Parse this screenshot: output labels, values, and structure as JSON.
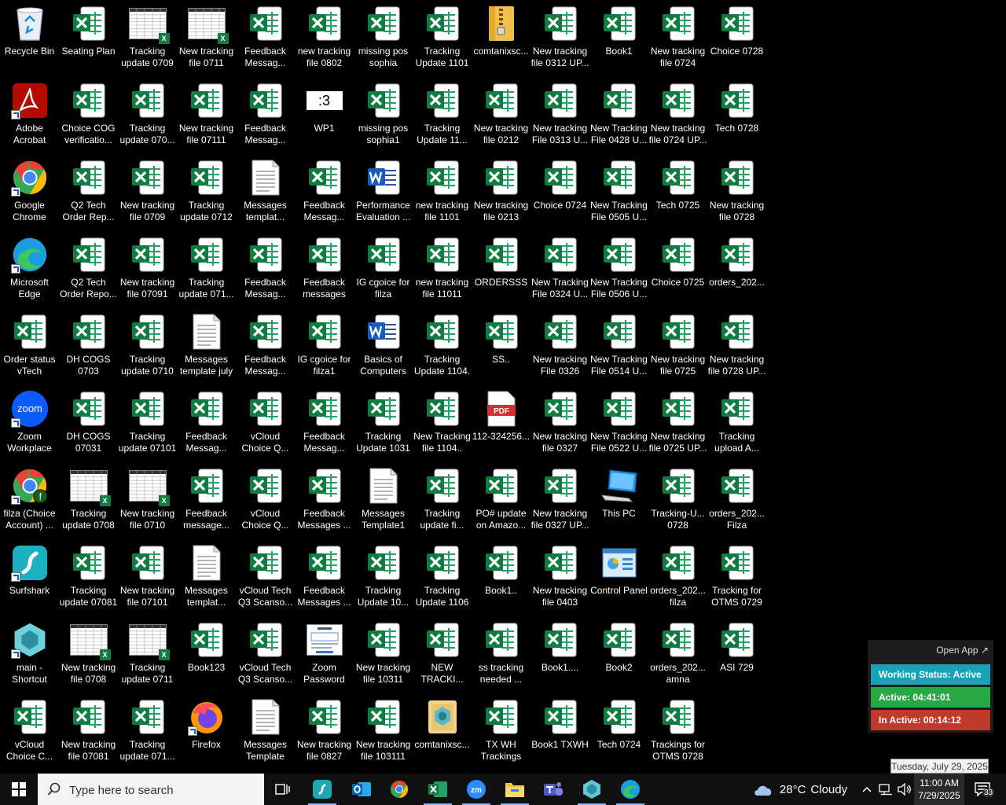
{
  "desktop": {
    "columns": [
      [
        {
          "label": "Recycle Bin",
          "type": "recycle"
        },
        {
          "label": "Adobe Acrobat",
          "type": "acrobat",
          "shortcut": true
        },
        {
          "label": "Google Chrome",
          "type": "chrome",
          "shortcut": true
        },
        {
          "label": "Microsoft Edge",
          "type": "edge",
          "shortcut": true
        },
        {
          "label": "Order status vTech",
          "type": "excel"
        },
        {
          "label": "Zoom Workplace",
          "type": "zoom",
          "shortcut": true
        },
        {
          "label": "filza (Choice Account) ...",
          "type": "chrome-profile",
          "shortcut": true
        },
        {
          "label": "Surfshark",
          "type": "surfshark",
          "shortcut": true
        },
        {
          "label": "main - Shortcut",
          "type": "main",
          "shortcut": true
        },
        {
          "label": "vCloud Choice C...",
          "type": "excel"
        }
      ],
      [
        {
          "label": "Seating Plan",
          "type": "excel"
        },
        {
          "label": "Choice COG verificatio...",
          "type": "excel"
        },
        {
          "label": "Q2 Tech Order Rep...",
          "type": "excel"
        },
        {
          "label": "Q2 Tech Order Repo...",
          "type": "excel"
        },
        {
          "label": "DH COGS 0703",
          "type": "excel"
        },
        {
          "label": "DH COGS 07031",
          "type": "excel"
        },
        {
          "label": "Tracking update 0708",
          "type": "sheet-thumb"
        },
        {
          "label": "Tracking update 07081",
          "type": "excel"
        },
        {
          "label": "New tracking file 0708",
          "type": "sheet-thumb"
        },
        {
          "label": "New tracking file 07081",
          "type": "excel"
        }
      ],
      [
        {
          "label": "Tracking update 0709",
          "type": "sheet-thumb"
        },
        {
          "label": "Tracking update 070...",
          "type": "excel"
        },
        {
          "label": "New tracking file 0709",
          "type": "excel"
        },
        {
          "label": "New tracking file 07091",
          "type": "excel"
        },
        {
          "label": "Tracking update 0710",
          "type": "excel"
        },
        {
          "label": "Tracking update 07101",
          "type": "excel"
        },
        {
          "label": "New tracking file 0710",
          "type": "sheet-thumb"
        },
        {
          "label": "New tracking file 07101",
          "type": "excel"
        },
        {
          "label": "Tracking update 0711",
          "type": "sheet-thumb"
        },
        {
          "label": "Tracking update 071...",
          "type": "excel"
        }
      ],
      [
        {
          "label": "New tracking file 0711",
          "type": "sheet-thumb"
        },
        {
          "label": "New tracking file 07111",
          "type": "excel"
        },
        {
          "label": "Tracking update 0712",
          "type": "excel"
        },
        {
          "label": "Tracking update 071...",
          "type": "excel"
        },
        {
          "label": "Messages template july",
          "type": "text"
        },
        {
          "label": "Feedback Messag...",
          "type": "excel"
        },
        {
          "label": "Feedback message...",
          "type": "excel"
        },
        {
          "label": "Messages templat...",
          "type": "text"
        },
        {
          "label": "Book123",
          "type": "excel"
        },
        {
          "label": "Firefox",
          "type": "firefox",
          "shortcut": true
        }
      ],
      [
        {
          "label": "Feedback Messag...",
          "type": "excel"
        },
        {
          "label": "Feedback Messag...",
          "type": "excel"
        },
        {
          "label": "Messages templat...",
          "type": "text"
        },
        {
          "label": "Feedback Messag...",
          "type": "excel"
        },
        {
          "label": "Feedback Messag...",
          "type": "excel"
        },
        {
          "label": "vCloud Choice Q...",
          "type": "excel"
        },
        {
          "label": "vCloud Choice Q...",
          "type": "excel"
        },
        {
          "label": "vCloud Tech Q3 Scanso...",
          "type": "excel"
        },
        {
          "label": "vCloud Tech Q3 Scanso...",
          "type": "excel"
        },
        {
          "label": "Messages Template",
          "type": "text"
        }
      ],
      [
        {
          "label": "new tracking file 0802",
          "type": "excel"
        },
        {
          "label": "WP1",
          "type": "wp",
          "glyph": ":3"
        },
        {
          "label": "Feedback Messag...",
          "type": "excel"
        },
        {
          "label": "Feedback messages",
          "type": "excel"
        },
        {
          "label": "IG cgoice for filza1",
          "type": "excel"
        },
        {
          "label": "Feedback Messag...",
          "type": "excel"
        },
        {
          "label": "Feedback Messages ...",
          "type": "excel"
        },
        {
          "label": "Feedback Messages ...",
          "type": "excel"
        },
        {
          "label": "Zoom Password",
          "type": "doc-thumb"
        },
        {
          "label": "New tracking file 0827",
          "type": "excel"
        }
      ],
      [
        {
          "label": "missing pos sophia",
          "type": "excel"
        },
        {
          "label": "missing pos sophia1",
          "type": "excel"
        },
        {
          "label": "Performance Evaluation ...",
          "type": "word"
        },
        {
          "label": "IG cgoice for filza",
          "type": "excel"
        },
        {
          "label": "Basics of Computers",
          "type": "word"
        },
        {
          "label": "Tracking Update 1031",
          "type": "excel"
        },
        {
          "label": "Messages Template1",
          "type": "text"
        },
        {
          "label": "Tracking Update 10...",
          "type": "excel"
        },
        {
          "label": "New tracking file 10311",
          "type": "excel"
        },
        {
          "label": "New tracking file 103111",
          "type": "excel"
        }
      ],
      [
        {
          "label": "Tracking Update 1101",
          "type": "excel"
        },
        {
          "label": "Tracking Update 11...",
          "type": "excel"
        },
        {
          "label": "new tracking file 1101",
          "type": "excel"
        },
        {
          "label": "new tracking file 11011",
          "type": "excel"
        },
        {
          "label": "Tracking Update 1104.",
          "type": "excel"
        },
        {
          "label": "New Tracking file 1104..",
          "type": "excel"
        },
        {
          "label": "Tracking update fi...",
          "type": "excel"
        },
        {
          "label": "Tracking Update 1106",
          "type": "excel"
        },
        {
          "label": "NEW TRACKI...",
          "type": "excel"
        },
        {
          "label": "comtanixsc...",
          "type": "comtanix"
        }
      ],
      [
        {
          "label": "comtanixsc...",
          "type": "zipfolder"
        },
        {
          "label": "New tracking file 0212",
          "type": "excel"
        },
        {
          "label": "New tracking file 0213",
          "type": "excel"
        },
        {
          "label": "ORDERSSS",
          "type": "excel"
        },
        {
          "label": "SS..",
          "type": "excel"
        },
        {
          "label": "112-324256...",
          "type": "pdf",
          "glyph": "PDF"
        },
        {
          "label": "PO# update on Amazo...",
          "type": "excel"
        },
        {
          "label": "Book1..",
          "type": "excel"
        },
        {
          "label": "ss tracking needed ...",
          "type": "excel"
        },
        {
          "label": "TX WH Trackings",
          "type": "excel"
        }
      ],
      [
        {
          "label": "New tracking file 0312 UP...",
          "type": "excel"
        },
        {
          "label": "New tracking File 0313 U...",
          "type": "excel"
        },
        {
          "label": "Choice 0724",
          "type": "excel"
        },
        {
          "label": "New Tracking File 0324 U...",
          "type": "excel"
        },
        {
          "label": "New tracking File 0326",
          "type": "excel"
        },
        {
          "label": "New tracking file 0327",
          "type": "excel"
        },
        {
          "label": "New tracking file 0327 UP...",
          "type": "excel"
        },
        {
          "label": "New tracking file 0403",
          "type": "excel"
        },
        {
          "label": "Book1....",
          "type": "excel"
        },
        {
          "label": "Book1 TXWH",
          "type": "excel"
        }
      ],
      [
        {
          "label": "Book1",
          "type": "excel"
        },
        {
          "label": "New Tracking File 0428 U...",
          "type": "excel"
        },
        {
          "label": "New Tracking File 0505 U...",
          "type": "excel"
        },
        {
          "label": "New Tracking File 0506 U...",
          "type": "excel"
        },
        {
          "label": "New Tracking File 0514 U...",
          "type": "excel"
        },
        {
          "label": "New Tracking File 0522 U...",
          "type": "excel"
        },
        {
          "label": "This PC",
          "type": "thispc"
        },
        {
          "label": "Control Panel",
          "type": "control"
        },
        {
          "label": "Book2",
          "type": "excel"
        },
        {
          "label": "Tech 0724",
          "type": "excel"
        }
      ],
      [
        {
          "label": "New tracking file 0724",
          "type": "excel"
        },
        {
          "label": "New tracking file 0724 UP...",
          "type": "excel"
        },
        {
          "label": "Tech 0725",
          "type": "excel"
        },
        {
          "label": "Choice 0725",
          "type": "excel"
        },
        {
          "label": "New tracking file 0725",
          "type": "excel"
        },
        {
          "label": "New tracking file 0725 UP...",
          "type": "excel"
        },
        {
          "label": "Tracking-U... 0728",
          "type": "excel"
        },
        {
          "label": "orders_202... filza",
          "type": "excel"
        },
        {
          "label": "orders_202... amna",
          "type": "excel"
        },
        {
          "label": "Trackings for OTMS 0728",
          "type": "excel"
        }
      ],
      [
        {
          "label": "Choice 0728",
          "type": "excel"
        },
        {
          "label": "Tech 0728",
          "type": "excel"
        },
        {
          "label": "New tracking file 0728",
          "type": "excel"
        },
        {
          "label": "orders_202...",
          "type": "excel"
        },
        {
          "label": "New tracking file 0728 UP...",
          "type": "excel"
        },
        {
          "label": "Tracking upload A...",
          "type": "excel"
        },
        {
          "label": "orders_202... Filza",
          "type": "excel"
        },
        {
          "label": "Tracking for OTMS 0729",
          "type": "excel"
        },
        {
          "label": "ASI 729",
          "type": "excel"
        }
      ]
    ]
  },
  "widget": {
    "open_app": "Open App ↗",
    "working_status": "Working Status: Active",
    "active": "Active: 04:41:01",
    "inactive": "In Active: 00:14:12",
    "colors": {
      "status": "#17a2b8",
      "active": "#28a745",
      "inactive": "#c0392b"
    }
  },
  "tooltip": "Tuesday, July 29, 2025",
  "taskbar": {
    "search_placeholder": "Type here to search",
    "apps": [
      "start-icon",
      "task-view-icon",
      "surfshark-icon",
      "outlook-icon",
      "chrome-icon",
      "excel-icon",
      "zoom-icon",
      "file-explorer-icon",
      "teams-icon",
      "main-app-icon",
      "edge-icon"
    ],
    "weather": {
      "temp": "28°C",
      "condition": "Cloudy"
    },
    "clock": {
      "time": "11:00 AM",
      "date": "7/29/2025"
    },
    "notifications": "33"
  }
}
